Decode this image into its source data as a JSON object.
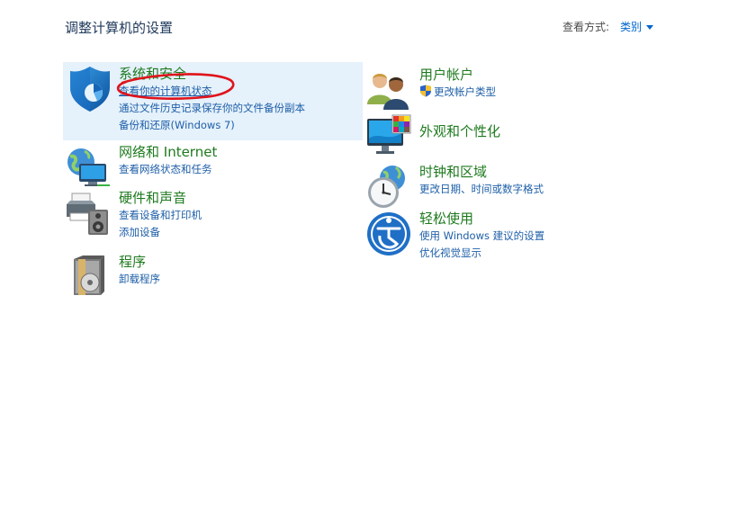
{
  "header": {
    "title": "调整计算机的设置",
    "view_by_label": "查看方式:",
    "view_by_value": "类别"
  },
  "left_categories": [
    {
      "title": "系统和安全",
      "icon": "shield-icon",
      "links": [
        "查看你的计算机状态",
        "通过文件历史记录保存你的文件备份副本",
        "备份和还原(Windows 7)"
      ]
    },
    {
      "title": "网络和 Internet",
      "icon": "network-globe-icon",
      "links": [
        "查看网络状态和任务"
      ]
    },
    {
      "title": "硬件和声音",
      "icon": "printer-speaker-icon",
      "links": [
        "查看设备和打印机",
        "添加设备"
      ]
    },
    {
      "title": "程序",
      "icon": "programs-disc-icon",
      "links": [
        "卸载程序"
      ]
    }
  ],
  "right_categories": [
    {
      "title": "用户帐户",
      "icon": "users-icon",
      "links": [
        "更改帐户类型"
      ]
    },
    {
      "title": "外观和个性化",
      "icon": "monitor-palette-icon",
      "links": []
    },
    {
      "title": "时钟和区域",
      "icon": "clock-globe-icon",
      "links": [
        "更改日期、时间或数字格式"
      ]
    },
    {
      "title": "轻松使用",
      "icon": "ease-of-access-icon",
      "links": [
        "使用 Windows 建议的设置",
        "优化视觉显示"
      ]
    }
  ],
  "colors": {
    "category_title": "#1e7a1e",
    "link": "#1e5fa8",
    "highlight_bg": "#e5f1fb",
    "annotation_red": "#e0131b"
  }
}
